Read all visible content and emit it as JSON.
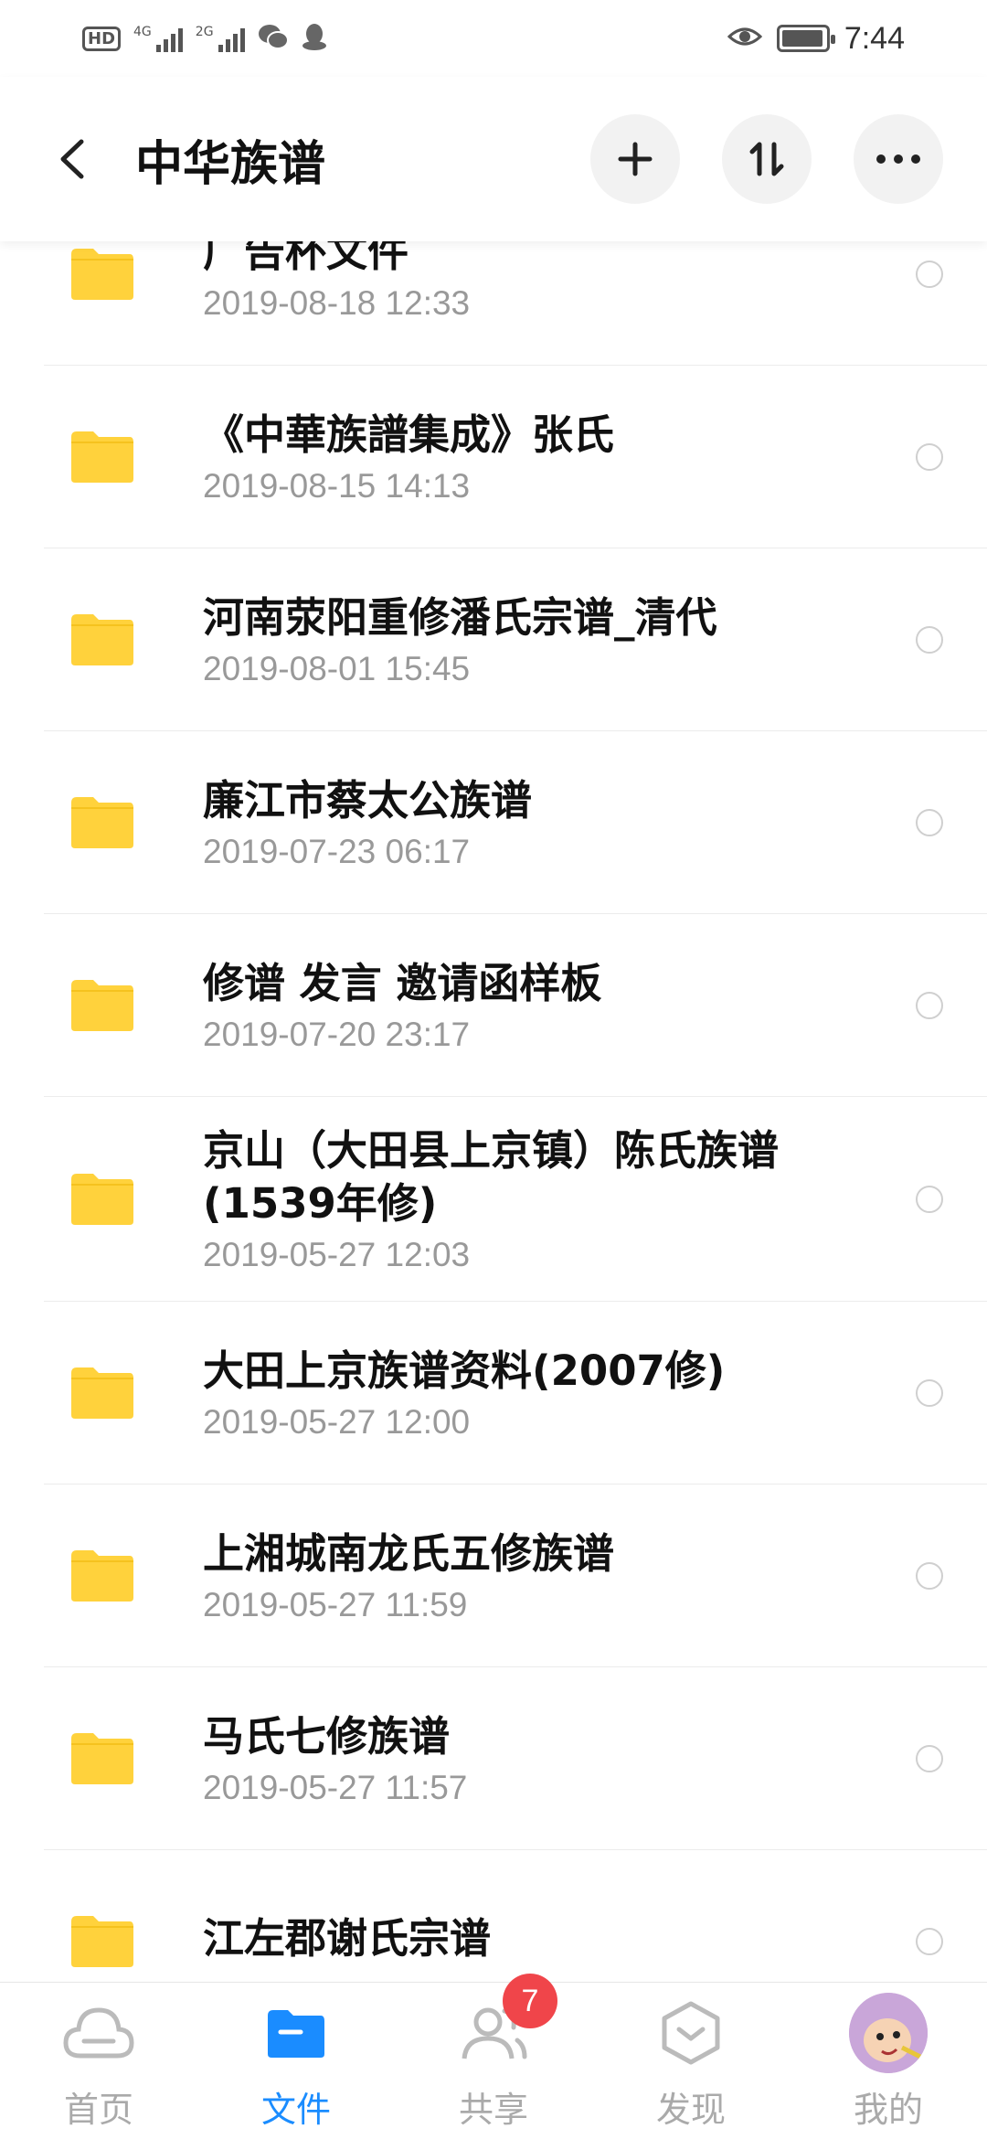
{
  "status": {
    "network1": "4G",
    "network2": "2G",
    "time": "7:44"
  },
  "header": {
    "title": "中华族谱"
  },
  "files": [
    {
      "name": "广告杯文件",
      "date": "2019-08-18  12:33"
    },
    {
      "name": "《中華族譜集成》张氏",
      "date": "2019-08-15  14:13"
    },
    {
      "name": "河南荥阳重修潘氏宗谱_清代",
      "date": "2019-08-01  15:45"
    },
    {
      "name": "廉江市蔡太公族谱",
      "date": "2019-07-23  06:17"
    },
    {
      "name": "修谱 发言 邀请函样板",
      "date": "2019-07-20  23:17"
    },
    {
      "name": "京山（大田县上京镇）陈氏族谱(1539年修)",
      "date": "2019-05-27  12:03"
    },
    {
      "name": "大田上京族谱资料(2007修)",
      "date": "2019-05-27  12:00"
    },
    {
      "name": "上湘城南龙氏五修族谱",
      "date": "2019-05-27  11:59"
    },
    {
      "name": "马氏七修族谱",
      "date": "2019-05-27  11:57"
    },
    {
      "name": "江左郡谢氏宗谱",
      "date": ""
    }
  ],
  "nav": {
    "home": "首页",
    "files": "文件",
    "share": "共享",
    "share_badge": "7",
    "discover": "发现",
    "mine": "我的"
  },
  "colors": {
    "accent": "#1a8cff",
    "folder": "#ffd23c",
    "badge": "#f0454a"
  }
}
